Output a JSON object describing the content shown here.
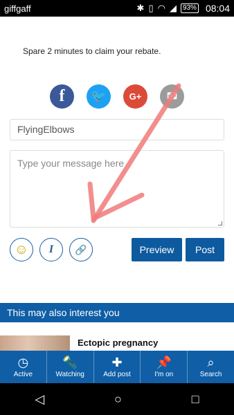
{
  "statusbar": {
    "carrier": "giffgaff",
    "battery": "93%",
    "time": "08:04"
  },
  "promo": {
    "text": "Spare 2 minutes to claim your rebate."
  },
  "share": {
    "facebook": "f",
    "twitter": "🐦",
    "googleplus": "G+",
    "email": "✉"
  },
  "form": {
    "name_value": "FlyingElbows",
    "message_placeholder": "Type your message here",
    "preview_label": "Preview",
    "post_label": "Post"
  },
  "tools": {
    "emoji": "☺",
    "italic": "I",
    "attach": "🔗"
  },
  "interest": {
    "heading": "This may also interest you",
    "card_title": "Ectopic pregnancy"
  },
  "tabs": [
    {
      "label": "Active",
      "icon": "clock-icon"
    },
    {
      "label": "Watching",
      "icon": "flashlight-icon"
    },
    {
      "label": "Add post",
      "icon": "plus-icon"
    },
    {
      "label": "I'm on",
      "icon": "pin-icon"
    },
    {
      "label": "Search",
      "icon": "search-icon"
    }
  ],
  "colors": {
    "brand_blue": "#0f5ea6",
    "facebook": "#3b5998",
    "twitter": "#1da1f2",
    "googleplus": "#dc4a38"
  }
}
